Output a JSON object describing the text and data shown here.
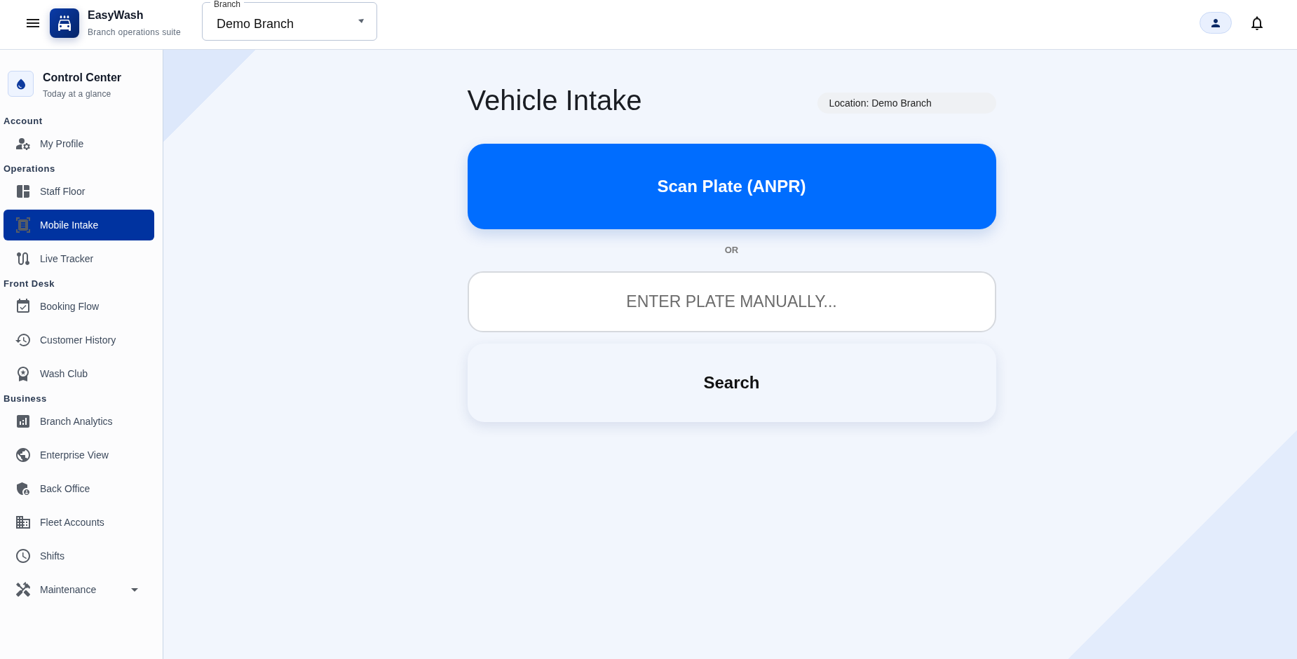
{
  "header": {
    "app_name": "EasyWash",
    "app_subtitle": "Branch operations suite",
    "branch_select": {
      "label": "Branch",
      "value": "Demo Branch"
    }
  },
  "sidebar": {
    "summary": {
      "title": "Control Center",
      "subtitle": "Today at a glance"
    },
    "sections": [
      {
        "heading": "Account",
        "items": [
          {
            "label": "My Profile",
            "selected": false
          }
        ]
      },
      {
        "heading": "Operations",
        "items": [
          {
            "label": "Staff Floor",
            "selected": false
          },
          {
            "label": "Mobile Intake",
            "selected": true
          },
          {
            "label": "Live Tracker",
            "selected": false
          }
        ]
      },
      {
        "heading": "Front Desk",
        "items": [
          {
            "label": "Booking Flow",
            "selected": false
          },
          {
            "label": "Customer History",
            "selected": false
          },
          {
            "label": "Wash Club",
            "selected": false
          }
        ]
      },
      {
        "heading": "Business",
        "items": [
          {
            "label": "Branch Analytics",
            "selected": false
          },
          {
            "label": "Enterprise View",
            "selected": false
          },
          {
            "label": "Back Office",
            "selected": false
          },
          {
            "label": "Fleet Accounts",
            "selected": false
          },
          {
            "label": "Shifts",
            "selected": false
          },
          {
            "label": "Maintenance",
            "selected": false,
            "expanded": false
          }
        ]
      }
    ]
  },
  "main": {
    "title": "Vehicle Intake",
    "location": "Location: Demo Branch",
    "scan_button": "Scan Plate (ANPR)",
    "divider": "OR",
    "plate_input": {
      "placeholder": "ENTER PLATE MANUALLY..."
    },
    "search_button": "Search"
  }
}
